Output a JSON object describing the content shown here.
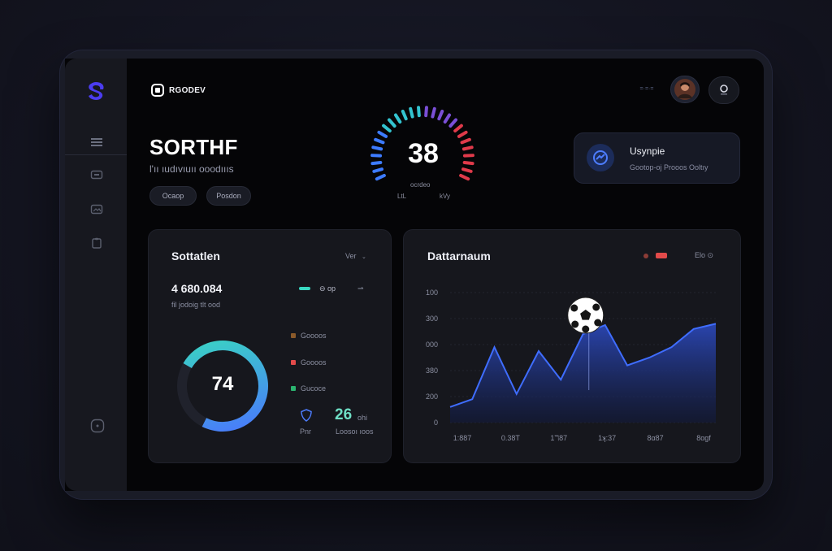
{
  "brand": {
    "name": "RGODEV"
  },
  "hero": {
    "title": "SORTHF",
    "subtitle": "l'ıı ıudıvıuıı ooodıııs",
    "pills": [
      "Ocaop",
      "Posdon"
    ]
  },
  "gauge": {
    "value": "38",
    "center_label": "ocrdeo",
    "left_label": "LtL",
    "right_label": "kVy",
    "level": 0.72
  },
  "topbar": {
    "menu_label": "=·=·="
  },
  "notification": {
    "title": "Usynpie",
    "subtitle": "Gootop-oj Prooos Ooltıy"
  },
  "card_left": {
    "title": "Sottatlen",
    "filter": "Ver",
    "big_value": "4 680.084",
    "big_sub": "fil jodoig tlt ood",
    "toggle_label": "⊖ op",
    "donut": {
      "value": "74",
      "fraction": 0.74
    },
    "legend": [
      {
        "label": "Goooos",
        "color": "#8a5a2a"
      },
      {
        "label": "Goooos",
        "color": "#e24a4a"
      },
      {
        "label": "Gucoce",
        "color": "#2bb36f"
      }
    ],
    "stat_icon_label": "Pnr",
    "stat_value": "26",
    "stat_unit": "ohi",
    "stat_sub": "Loosoı ıoos"
  },
  "card_right": {
    "title": "Dattarnaum",
    "menu": "Elo ⊙",
    "chart_data": {
      "type": "area",
      "y_ticks": [
        "100",
        "300",
        "000",
        "380",
        "200",
        "0"
      ],
      "x_ticks": [
        "1:887",
        "0.38T",
        "1ℸ87",
        "1ʞ:37",
        "8α87",
        "8ɑgf"
      ],
      "x": [
        0,
        1,
        2,
        3,
        4,
        5,
        6,
        7,
        8,
        9,
        10,
        11,
        12
      ],
      "y": [
        12,
        18,
        58,
        22,
        55,
        33,
        68,
        75,
        44,
        50,
        58,
        72,
        76
      ],
      "ylim": [
        0,
        100
      ]
    }
  },
  "colors": {
    "accent": "#3b66ff",
    "teal": "#39d8c1",
    "donut_blue": "#4a74ff",
    "gauge_red": "#e03a4a"
  }
}
